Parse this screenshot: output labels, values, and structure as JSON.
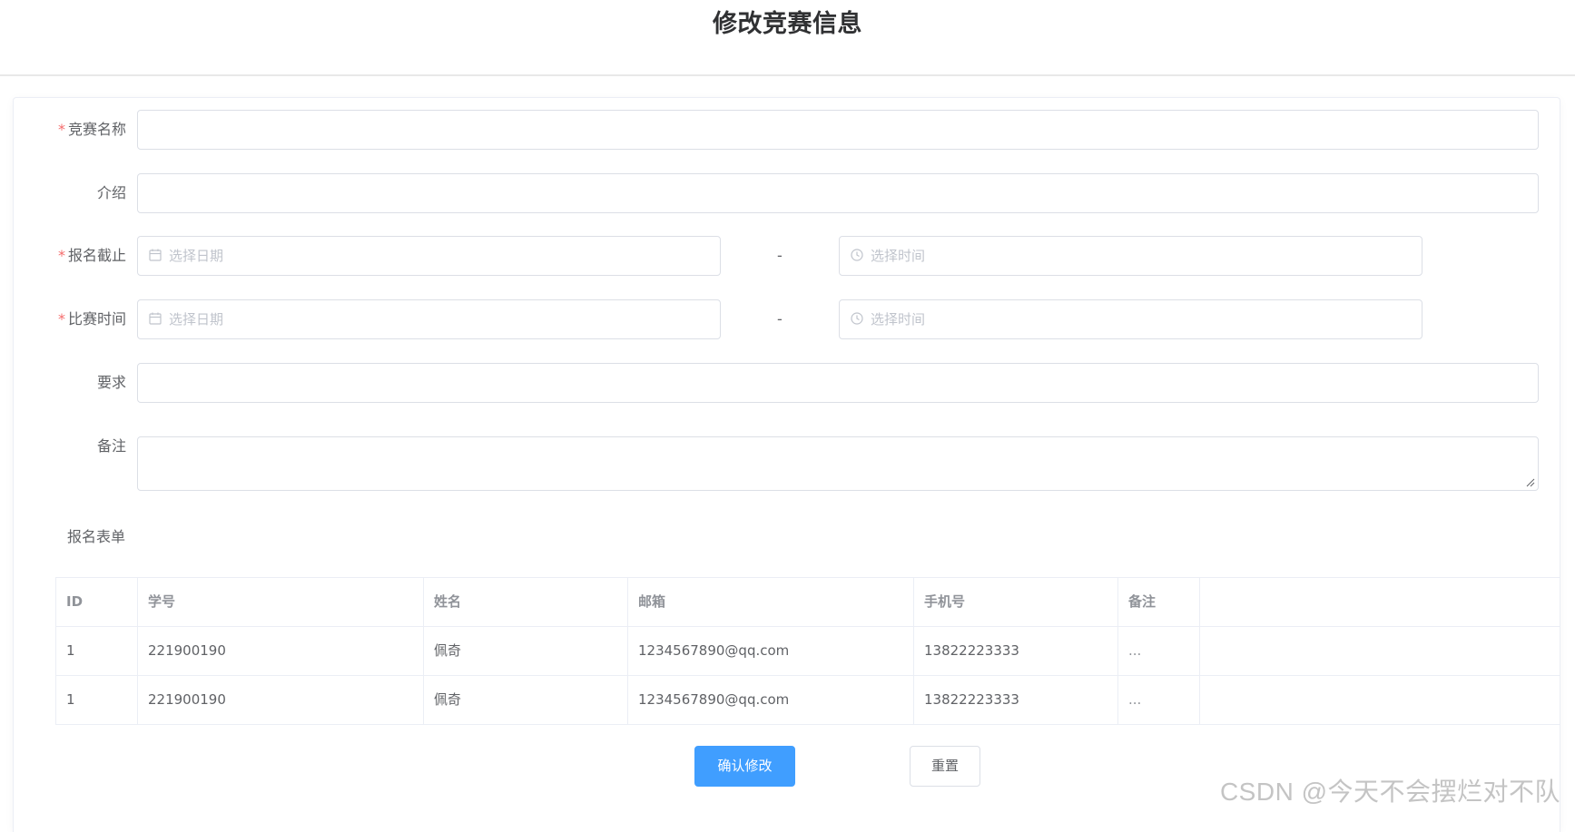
{
  "page": {
    "title": "修改竞赛信息"
  },
  "form": {
    "name_label": "竞赛名称",
    "intro_label": "介绍",
    "deadline_label": "报名截止",
    "match_time_label": "比赛时间",
    "requirement_label": "要求",
    "remark_label": "备注",
    "required_mark": "*",
    "date_placeholder": "选择日期",
    "time_placeholder": "选择时间",
    "range_separator": "-",
    "signup_form_label": "报名表单",
    "name_value": "",
    "intro_value": "",
    "requirement_value": "",
    "remark_value": ""
  },
  "table": {
    "headers": [
      "ID",
      "学号",
      "姓名",
      "邮箱",
      "手机号",
      "备注"
    ],
    "rows": [
      [
        "1",
        "221900190",
        "佩奇",
        "1234567890@qq.com",
        "13822223333",
        "..."
      ],
      [
        "1",
        "221900190",
        "佩奇",
        "1234567890@qq.com",
        "13822223333",
        "..."
      ]
    ]
  },
  "buttons": {
    "confirm_label": "确认修改",
    "reset_label": "重置"
  },
  "watermark": "CSDN @今天不会摆烂对不队",
  "colors": {
    "primary": "#409eff",
    "required": "#f56c6c",
    "border": "#dcdfe6",
    "placeholder": "#c0c4cc"
  },
  "icons": {
    "date": "calendar-icon",
    "time": "clock-icon",
    "resize": "resize-handle-icon"
  }
}
